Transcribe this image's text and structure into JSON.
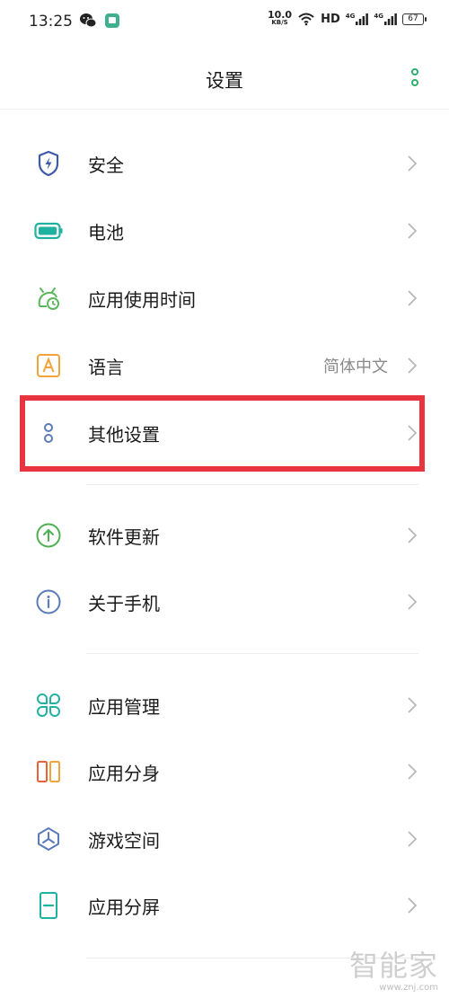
{
  "status_bar": {
    "time": "13:25",
    "net_speed_value": "10.0",
    "net_speed_unit": "KB/S",
    "hd": "HD",
    "signal_4g_1": "4G",
    "signal_4g_2": "4G",
    "battery": "67"
  },
  "header": {
    "title": "设置"
  },
  "items": [
    {
      "label": "安全"
    },
    {
      "label": "电池"
    },
    {
      "label": "应用使用时间"
    },
    {
      "label": "语言",
      "value": "简体中文"
    },
    {
      "label": "其他设置"
    },
    {
      "label": "软件更新"
    },
    {
      "label": "关于手机"
    },
    {
      "label": "应用管理"
    },
    {
      "label": "应用分身"
    },
    {
      "label": "游戏空间"
    },
    {
      "label": "应用分屏"
    }
  ],
  "icons": {
    "security": "shield-bolt-icon",
    "battery": "battery-icon",
    "app_usage": "timer-icon",
    "language": "letter-a-icon",
    "other_settings": "two-dots-icon",
    "software_update": "arrow-up-circle-icon",
    "about_phone": "info-circle-icon",
    "app_management": "four-loops-icon",
    "app_clone": "two-rectangles-icon",
    "game_space": "game-space-icon",
    "split_screen": "split-screen-icon"
  },
  "colors": {
    "accent_green": "#2db06b",
    "highlight_red": "#e8343f",
    "icon_blue": "#3d5ba8",
    "icon_teal": "#20b2a0",
    "icon_orange": "#f2a33a"
  },
  "watermark": {
    "logo": "智能家",
    "url": "www.znj.com"
  }
}
